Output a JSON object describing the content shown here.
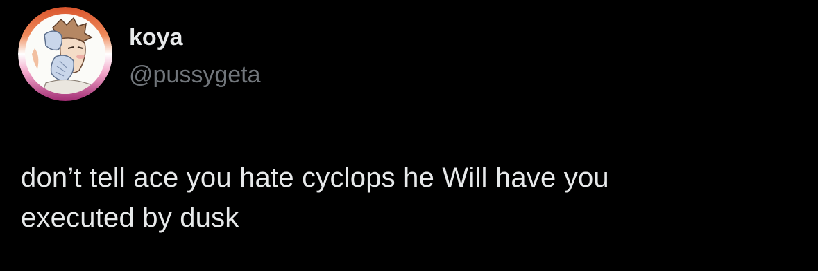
{
  "tweet": {
    "author": {
      "display_name": "koya",
      "handle": "@pussygeta",
      "avatar_icon": "avatar-illustration"
    },
    "text_lines": [
      "don’t tell ace you hate cyclops he Will have you",
      "executed by dusk"
    ]
  },
  "colors": {
    "background": "#000000",
    "primary_text": "#e7e9ea",
    "secondary_text": "#71767b",
    "avatar_ring_top": "#d9542c",
    "avatar_ring_mid": "#f2a6c9",
    "avatar_ring_bottom": "#a22d74"
  }
}
